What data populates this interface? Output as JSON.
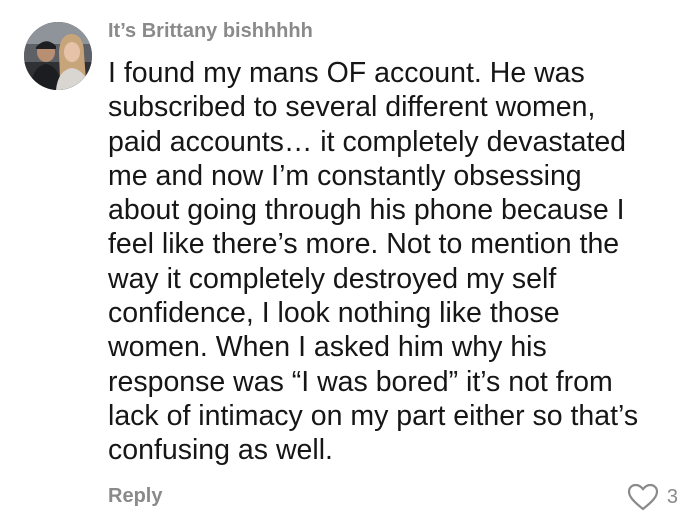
{
  "comment": {
    "username": "It’s Brittany bishhhhh",
    "text_lines": [
      "I found my mans OF account. He was",
      "subscribed to several different women,",
      "paid accounts… it completely devastated",
      "me and now I’m constantly obsessing",
      "about going through his phone because I",
      "feel like there’s more. Not to mention the",
      "way it completely destroyed my self",
      "confidence, I look nothing like those",
      "women. When I asked him why his",
      "response was “I was bored” it’s not from",
      "lack of intimacy on my part either so that’s",
      "confusing as well."
    ],
    "reply_label": "Reply",
    "like_count": "3",
    "like_icon": "heart-outline-icon",
    "avatar_icon": "profile-photo-avatar"
  },
  "colors": {
    "meta_text": "#8a8a8a",
    "body_text": "#161616",
    "background": "#ffffff"
  }
}
